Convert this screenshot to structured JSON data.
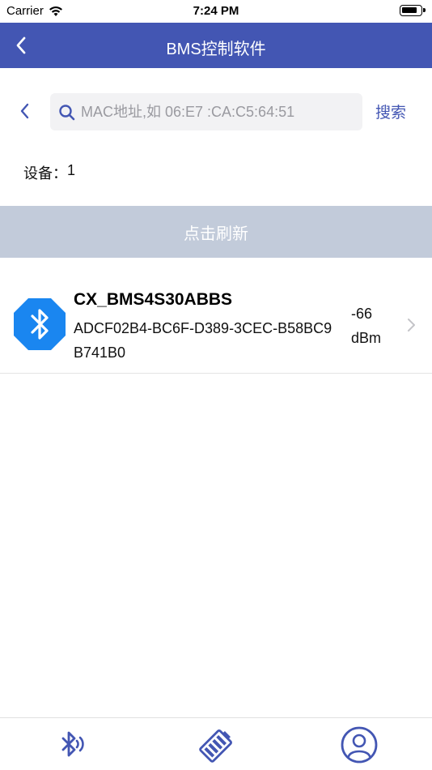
{
  "status_bar": {
    "carrier": "Carrier",
    "time": "7:24 PM"
  },
  "navbar": {
    "title": "BMS控制软件"
  },
  "search": {
    "placeholder": "MAC地址,如 06:E7 :CA:C5:64:51",
    "button_label": "搜索"
  },
  "device_count": {
    "label": "设备：",
    "value": "1"
  },
  "refresh_button": {
    "label": "点击刷新"
  },
  "devices": [
    {
      "name": "CX_BMS4S30ABBS",
      "uuid": "ADCF02B4-BC6F-D389-3CEC-B58BC9B741B0",
      "rssi": "-66 dBm"
    }
  ],
  "tabs": [
    {
      "icon": "bluetooth-scan-icon"
    },
    {
      "icon": "battery-icon"
    },
    {
      "icon": "user-icon"
    }
  ],
  "colors": {
    "primary": "#4356b3",
    "refresh_bg": "#c2cbda",
    "bluetooth_blue": "#1a86f0"
  }
}
